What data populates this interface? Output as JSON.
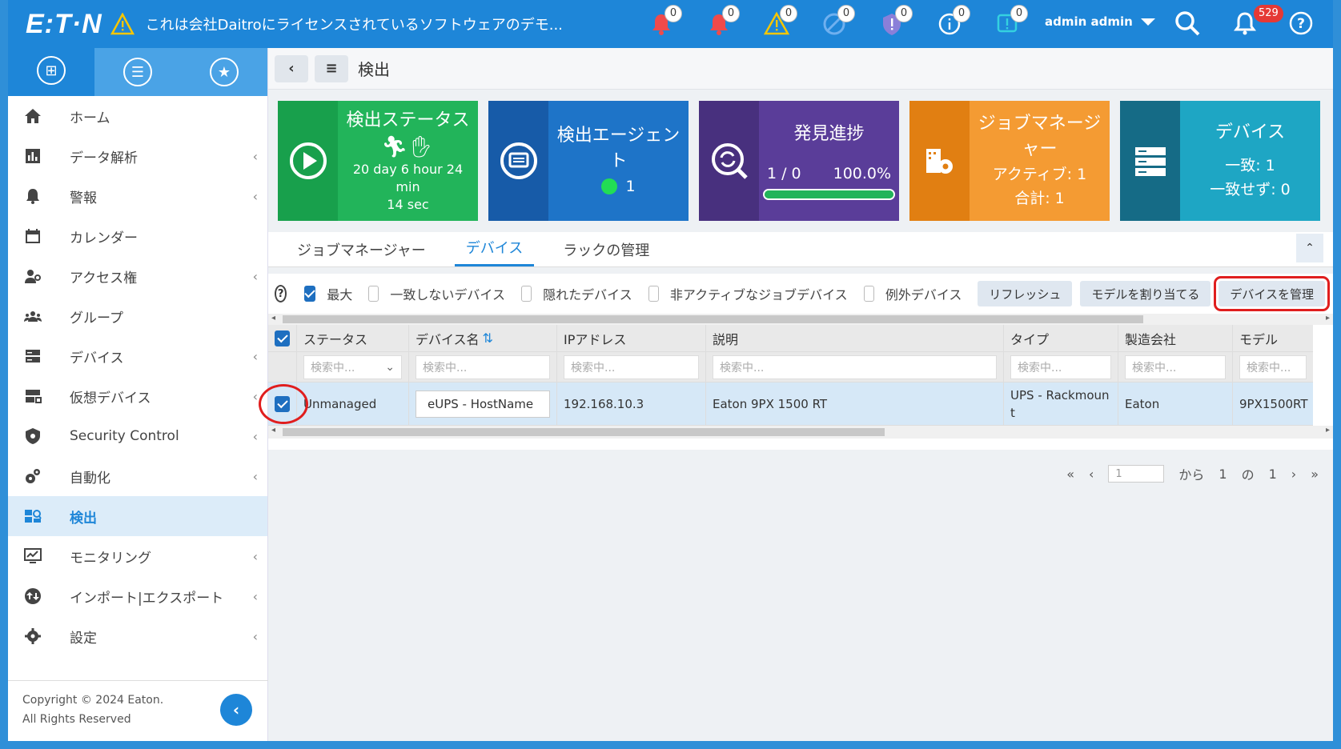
{
  "header": {
    "logo": "E:T·N",
    "banner": "これは会社Daitroにライセンスされているソフトウェアのデモ...",
    "badges": [
      "0",
      "0",
      "0",
      "0",
      "0",
      "0",
      "0"
    ],
    "user": "admin admin",
    "notif_count": "529"
  },
  "sidebar": {
    "items": [
      {
        "label": "ホーム"
      },
      {
        "label": "データ解析"
      },
      {
        "label": "警報"
      },
      {
        "label": "カレンダー"
      },
      {
        "label": "アクセス権"
      },
      {
        "label": "グループ"
      },
      {
        "label": "デバイス"
      },
      {
        "label": "仮想デバイス"
      },
      {
        "label": "Security Control"
      },
      {
        "label": "自動化"
      },
      {
        "label": "検出"
      },
      {
        "label": "モニタリング"
      },
      {
        "label": "インポート|エクスポート"
      },
      {
        "label": "設定"
      }
    ],
    "footer_line1": "Copyright © 2024 Eaton.",
    "footer_line2": "All Rights Reserved"
  },
  "breadcrumb": {
    "title": "検出"
  },
  "cards": {
    "status": {
      "title": "検出ステータス",
      "time_line1": "20 day 6 hour 24 min",
      "time_line2": "14 sec"
    },
    "agent": {
      "title_line1": "検出エージェン",
      "title_line2": "ト",
      "count": "1"
    },
    "progress": {
      "title": "発見進捗",
      "ratio": "1 / 0",
      "percent": "100.0%",
      "fill": 1.0
    },
    "job": {
      "title_line1": "ジョブマネージ",
      "title_line2": "ャー",
      "active": "アクティブ: 1",
      "total": "合計: 1"
    },
    "device": {
      "title": "デバイス",
      "match": "一致: 1",
      "mismatch": "一致せず: 0"
    }
  },
  "tabs": [
    "ジョブマネージャー",
    "デバイス",
    "ラックの管理"
  ],
  "filters": {
    "max": "最大",
    "unmatched": "一致しないデバイス",
    "hidden": "隠れたデバイス",
    "inactive": "非アクティブなジョブデバイス",
    "exception": "例外デバイス",
    "refresh": "リフレッシュ",
    "assign_model": "モデルを割り当てる",
    "manage_device": "デバイスを管理"
  },
  "table": {
    "columns": [
      "ステータス",
      "デバイス名",
      "IPアドレス",
      "説明",
      "タイプ",
      "製造会社",
      "モデル"
    ],
    "search_placeholder": "検索中...",
    "rows": [
      {
        "status": "Unmanaged",
        "name": "eUPS - HostName",
        "ip": "192.168.10.3",
        "desc": "Eaton 9PX 1500 RT",
        "type_line1": "UPS - Rackmoun",
        "type_line2": "t",
        "maker": "Eaton",
        "model": "9PX1500RT"
      }
    ]
  },
  "pager": {
    "page": "1",
    "from": "から",
    "current": "1",
    "of": "の",
    "total": "1"
  }
}
